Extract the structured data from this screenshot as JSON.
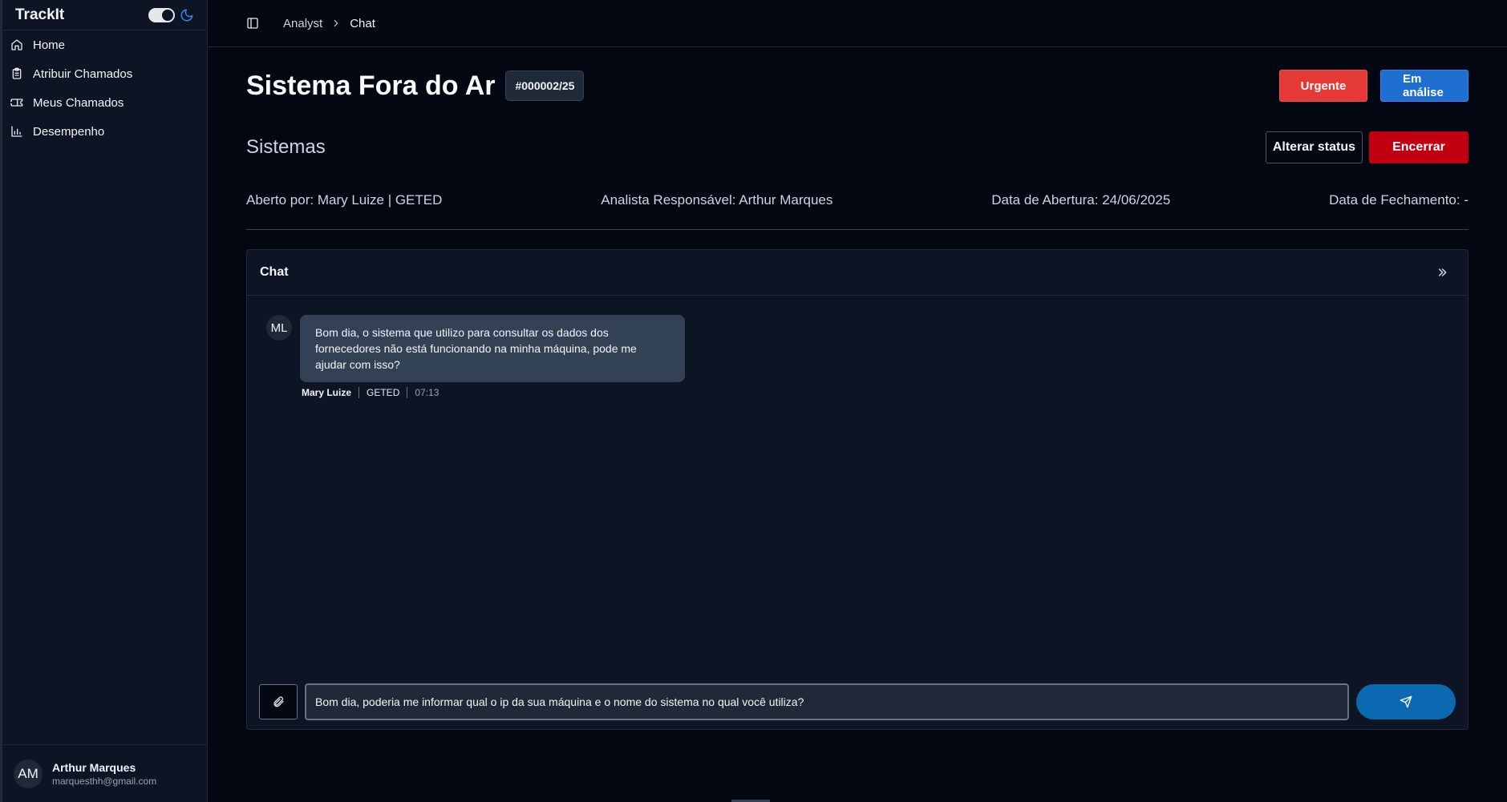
{
  "app": {
    "name": "TrackIt"
  },
  "sidebar": {
    "items": [
      {
        "label": "Home",
        "icon": "home-icon"
      },
      {
        "label": "Atribuir Chamados",
        "icon": "clipboard-icon"
      },
      {
        "label": "Meus Chamados",
        "icon": "ticket-icon"
      },
      {
        "label": "Desempenho",
        "icon": "bar-chart-icon"
      }
    ],
    "user": {
      "initials": "AM",
      "name": "Arthur Marques",
      "email": "marquesthh@gmail.com"
    }
  },
  "breadcrumb": {
    "parent": "Analyst",
    "current": "Chat"
  },
  "ticket": {
    "title": "Sistema Fora do Ar",
    "number": "#000002/25",
    "priority": "Urgente",
    "status": "Em análise",
    "category": "Sistemas",
    "opened_by": "Aberto por: Mary Luize | GETED",
    "analyst": "Analista Responsável: Arthur Marques",
    "open_date": "Data de Abertura: 24/06/2025",
    "close_date": "Data de Fechamento: -"
  },
  "actions": {
    "change_status": "Alterar status",
    "close": "Encerrar"
  },
  "chat": {
    "title": "Chat",
    "messages": [
      {
        "initials": "ML",
        "text": "Bom dia, o sistema que utilizo para consultar os dados dos fornecedores não está funcionando na minha máquina, pode me ajudar com isso?",
        "author": "Mary Luize",
        "department": "GETED",
        "time": "07:13"
      }
    ],
    "draft": "Bom dia, poderia me informar qual o ip da sua máquina e o nome do sistema no qual você utiliza?"
  },
  "colors": {
    "background": "#030712",
    "urgent": "#e53935",
    "analysis": "#1e6fd0",
    "close": "#c00010",
    "send": "#0b69b1",
    "accent_moon": "#3b82f6"
  }
}
